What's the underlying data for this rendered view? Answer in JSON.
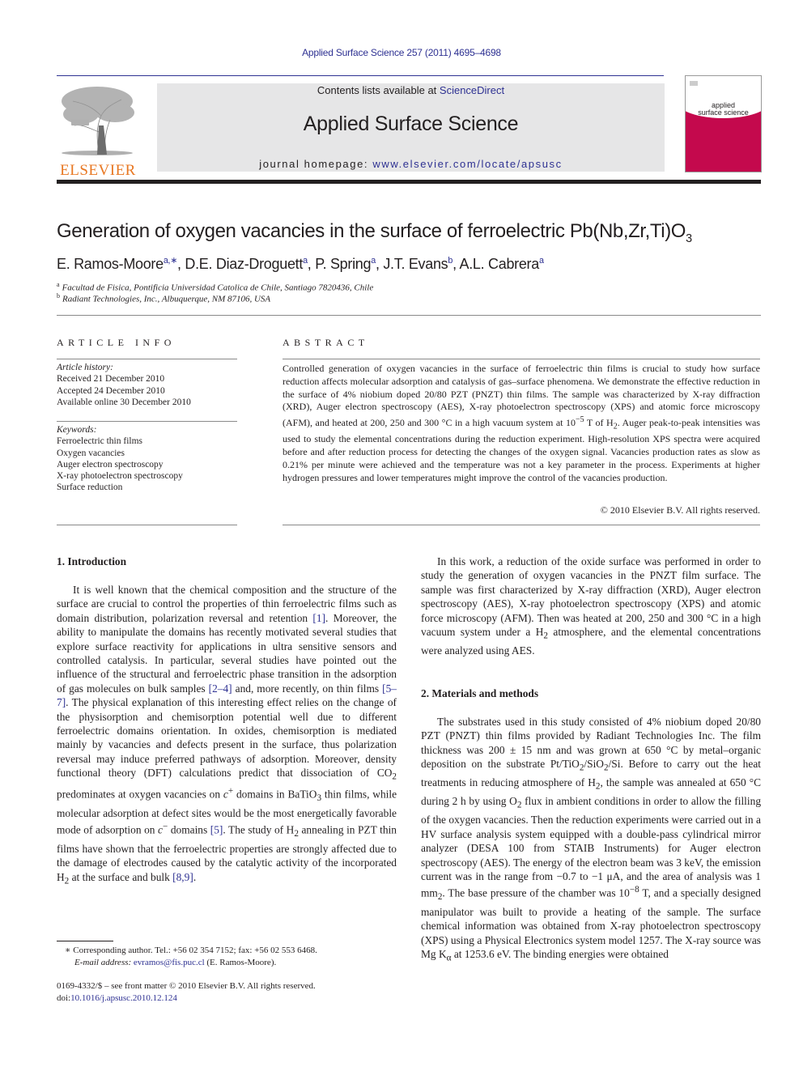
{
  "header": {
    "citation": "Applied Surface Science 257 (2011) 4695–4698",
    "contents_prefix": "Contents lists available at ",
    "contents_link": "ScienceDirect",
    "journal_title": "Applied Surface Science",
    "homepage_prefix": "journal homepage: ",
    "homepage_link": "www.elsevier.com/locate/apsusc",
    "publisher_wordmark": "ELSEVIER",
    "cover_title_line1": "applied",
    "cover_title_line2": "surface science",
    "colors": {
      "link": "#2e3192",
      "elsevier_orange": "#e87722",
      "cover_magenta": "#c4094d",
      "banner_gray": "#e6e6e7"
    }
  },
  "article": {
    "title_main": "Generation of oxygen vacancies in the surface of ferroelectric Pb(Nb,Zr,Ti)O",
    "title_sub": "3",
    "authors": [
      {
        "name": "E. Ramos-Moore",
        "aff": "a,∗",
        "sep": ", "
      },
      {
        "name": "D.E. Diaz-Droguett",
        "aff": "a",
        "sep": ", "
      },
      {
        "name": "P. Spring",
        "aff": "a",
        "sep": ", "
      },
      {
        "name": "J.T. Evans",
        "aff": "b",
        "sep": ", "
      },
      {
        "name": "A.L. Cabrera",
        "aff": "a",
        "sep": ""
      }
    ],
    "affiliations": [
      {
        "key": "a",
        "text": "Facultad de Fisica, Pontificia Universidad Catolica de Chile, Santiago 7820436, Chile"
      },
      {
        "key": "b",
        "text": "Radiant Technologies, Inc., Albuquerque, NM 87106, USA"
      }
    ]
  },
  "article_info": {
    "heading": "ARTICLE INFO",
    "history_label": "Article history:",
    "history": [
      "Received 21 December 2010",
      "Accepted 24 December 2010",
      "Available online 30 December 2010"
    ],
    "keywords_label": "Keywords:",
    "keywords": [
      "Ferroelectric thin films",
      "Oxygen vacancies",
      "Auger electron spectroscopy",
      "X-ray photoelectron spectroscopy",
      "Surface reduction"
    ]
  },
  "abstract": {
    "heading": "ABSTRACT",
    "text_1": "Controlled generation of oxygen vacancies in the surface of ferroelectric thin films is crucial to study how surface reduction affects molecular adsorption and catalysis of gas–surface phenomena. We demonstrate the effective reduction in the surface of 4% niobium doped 20/80 PZT (PNZT) thin films. The sample was characterized by X-ray diffraction (XRD), Auger electron spectroscopy (AES), X-ray photoelectron spectroscopy (XPS) and atomic force microscopy (AFM), and heated at 200, 250 and 300 °C in a high vacuum system at 10",
    "text_exp": "−5",
    "text_2": " T of H",
    "text_sub": "2",
    "text_3": ". Auger peak-to-peak intensities was used to study the elemental concentrations during the reduction experiment. High-resolution XPS spectra were acquired before and after reduction process for detecting the changes of the oxygen signal. Vacancies production rates as slow as 0.21% per minute were achieved and the temperature was not a key parameter in the process. Experiments at higher hydrogen pressures and lower temperatures might improve the control of the vacancies production.",
    "copyright": "© 2010 Elsevier B.V. All rights reserved."
  },
  "intro": {
    "heading": "1.  Introduction",
    "p1": [
      "It is well known that the chemical composition and the structure of the surface are crucial to control the properties of thin ferroelectric films such as domain distribution, polarization reversal and retention ",
      "[1]",
      ". Moreover, the ability to manipulate the domains has recently motivated several studies that explore surface reactivity for applications in ultra sensitive sensors and controlled catalysis. In particular, several studies have pointed out the influence of the structural and ferroelectric phase transition in the adsorption of gas molecules on bulk samples ",
      "[2–4]",
      " and, more recently, on thin films ",
      "[5–7]",
      ". The physical explanation of this interesting effect relies on the change of the physisorption and chemisorption potential well due to different ferroelectric domains orientation. In oxides, chemisorption is mediated mainly by vacancies and defects present in the surface, thus polarization reversal may induce preferred pathways of adsorption. Moreover, density functional theory (DFT) calculations predict that dissociation of CO",
      "2",
      " predominates at oxygen vacancies on ",
      "c",
      "+",
      " domains in BaTiO",
      "3",
      " thin films, while molecular adsorption at defect sites would be the most energetically favorable mode of adsorption on ",
      "c",
      "−",
      " domains ",
      "[5]",
      ". The study of H",
      "2",
      " annealing in PZT thin films have shown that the ferroelectric properties are strongly affected due to the damage of electrodes caused by the catalytic activity of the incorporated H",
      "2",
      " at the surface and bulk ",
      "[8,9]",
      "."
    ],
    "p2": [
      "In this work, a reduction of the oxide surface was performed in order to study the generation of oxygen vacancies in the PNZT film surface. The sample was first characterized by X-ray diffraction (XRD), Auger electron spectroscopy (AES), X-ray photoelectron spectroscopy (XPS) and atomic force microscopy (AFM). Then was heated at 200, 250 and 300 °C in a high vacuum system under a H",
      "2",
      " atmosphere, and the elemental concentrations were analyzed using AES."
    ]
  },
  "methods": {
    "heading": "2.  Materials and methods",
    "p1": [
      "The substrates used in this study consisted of 4% niobium doped 20/80 PZT (PNZT) thin films provided by Radiant Technologies Inc. The film thickness was 200 ± 15 nm and was grown at 650 °C by metal–organic deposition on the substrate Pt/TiO",
      "2",
      "/SiO",
      "2",
      "/Si. Before to carry out the heat treatments in reducing atmosphere of H",
      "2",
      ", the sample was annealed at 650 °C during 2 h by using O",
      "2",
      " flux in ambient conditions in order to allow the filling of the oxygen vacancies. Then the reduction experiments were carried out in a HV surface analysis system equipped with a double-pass cylindrical mirror analyzer (DESA 100 from STAIB Instruments) for Auger electron spectroscopy (AES). The energy of the electron beam was 3 keV, the emission current was in the range from −0.7 to −1 μA, and the area of analysis was 1 mm",
      "2",
      ". The base pressure of the chamber was 10",
      "−8",
      " T, and a specially designed manipulator was built to provide a heating of the sample. The surface chemical information was obtained from X-ray photoelectron spectroscopy (XPS) using a Physical Electronics system model 1257. The X-ray source was Mg K",
      "α",
      " at 1253.6 eV. The binding energies were obtained"
    ]
  },
  "footnotes": {
    "corresponding": "∗  Corresponding author. Tel.: +56 02 354 7152; fax: +56 02 553 6468.",
    "email_label": "E-mail address: ",
    "email": "evramos@fis.puc.cl",
    "email_suffix": " (E. Ramos-Moore).",
    "front_matter": "0169-4332/$ – see front matter © 2010 Elsevier B.V. All rights reserved.",
    "doi_label": "doi:",
    "doi": "10.1016/j.apsusc.2010.12.124"
  }
}
